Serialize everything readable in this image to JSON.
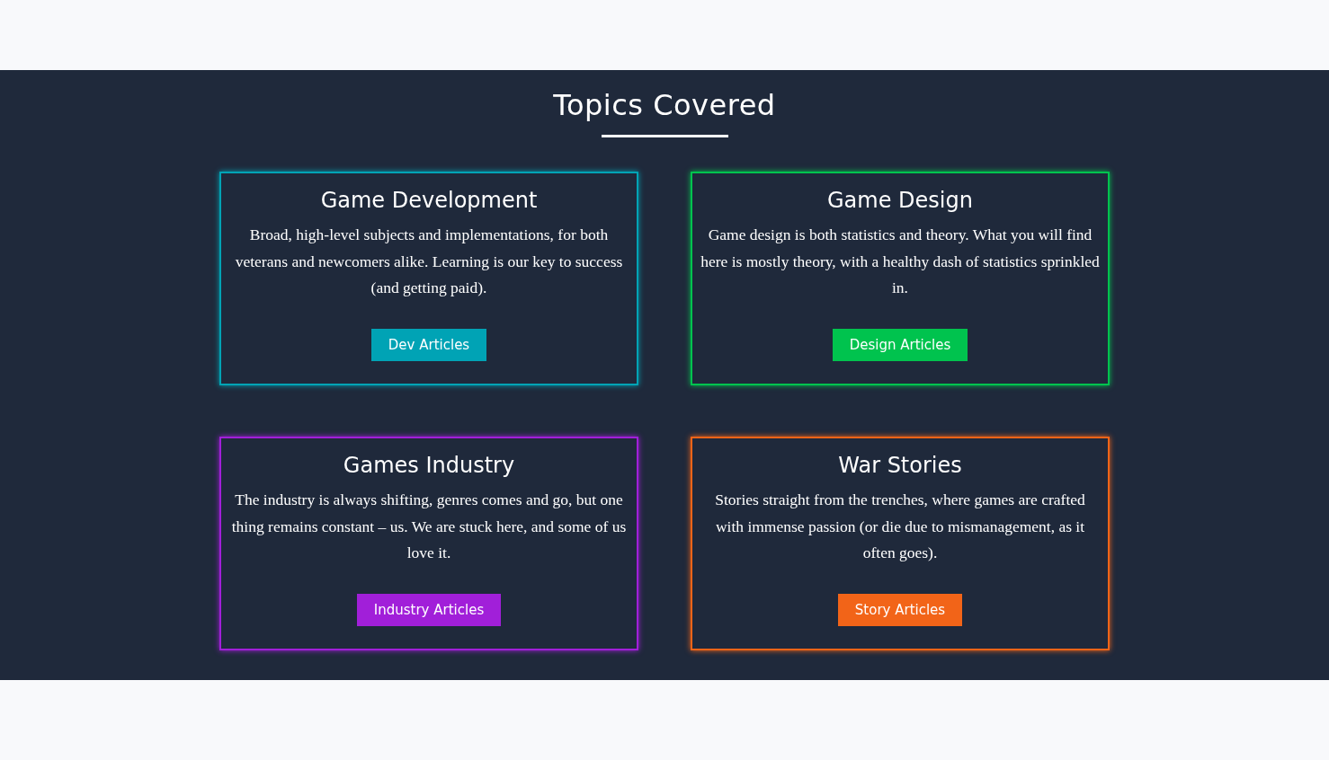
{
  "section": {
    "title": "Topics Covered"
  },
  "topics": [
    {
      "title": "Game Development",
      "description": "Broad, high-level subjects and implementations, for both veterans and newcomers alike. Learning is our key to success (and getting paid).",
      "button": "Dev Articles",
      "color": "#00a3b5"
    },
    {
      "title": "Game Design",
      "description": "Game design is both statistics and theory. What you will find here is mostly theory, with a healthy dash of statistics sprinkled in.",
      "button": "Design Articles",
      "color": "#00c34e"
    },
    {
      "title": "Games Industry",
      "description": "The industry is always shifting, genres comes and go, but one thing remains constant – us. We are stuck here, and some of us love it.",
      "button": "Industry Articles",
      "color": "#a11fd9"
    },
    {
      "title": "War Stories",
      "description": "Stories straight from the trenches, where games are crafted with immense passion (or die due to mismanagement, as it often goes).",
      "button": "Story Articles",
      "color": "#f26418"
    }
  ]
}
